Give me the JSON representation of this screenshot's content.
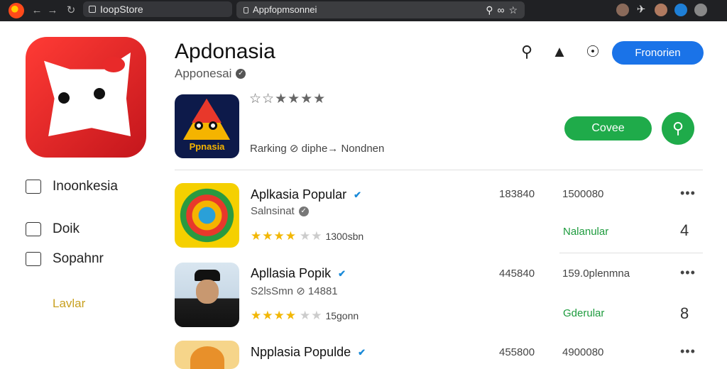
{
  "browser": {
    "tab_title": "IoopStore",
    "url": "Appfopmsonnei"
  },
  "app": {
    "title": "Apdonasia",
    "developer": "Apponesai",
    "primary_button": "Fronorien",
    "featured_icon_label": "Ppnasia",
    "ranking_text": "Rarking  ⊘  diphe→ Nondnen",
    "install_button": "Covee"
  },
  "sidebar": {
    "items": [
      {
        "label": "Inoonkesia",
        "icon": "image-icon"
      },
      {
        "label": "Doik",
        "icon": "home-icon"
      },
      {
        "label": "Sopahnr",
        "icon": "arrow-box-icon"
      }
    ],
    "footer_link": "Lavlar"
  },
  "list": [
    {
      "title": "Aplkasia Popular",
      "badge": "✔",
      "sub": "Salnsinat",
      "rating_count": "1300sbn",
      "stat1": "183840",
      "stat2": "1500080",
      "status": "Nalanular",
      "glyph": "4"
    },
    {
      "title": "Apllasia Popik",
      "badge": "✔",
      "sub": "S2lsSmn  ⊘  14881",
      "rating_count": "15gonn",
      "stat1": "445840",
      "stat2": "159.0plenmna",
      "status": "Gderular",
      "glyph": "8"
    },
    {
      "title": "Npplasia Populde",
      "badge": "✔",
      "sub": "",
      "rating_count": "",
      "stat1": "455800",
      "stat2": "4900080",
      "status": "",
      "glyph": ""
    }
  ],
  "colors": {
    "accent_blue": "#1a73e8",
    "accent_green": "#1fab4a",
    "app_red": "#e8262a",
    "star_gold": "#f2b705"
  }
}
